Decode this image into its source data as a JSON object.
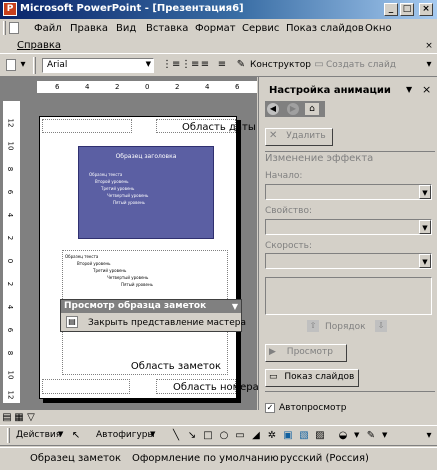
{
  "window": {
    "title": "Microsoft PowerPoint - [Презентация6]"
  },
  "menu": [
    "Файл",
    "Правка",
    "Вид",
    "Вставка",
    "Формат",
    "Сервис",
    "Показ слайдов",
    "Окно",
    "Справка"
  ],
  "formatting": {
    "font": "Arial",
    "designer": "Конструктор",
    "new_slide": "Создать слайд"
  },
  "ruler_top": [
    "6",
    "4",
    "2",
    "0",
    "2",
    "4",
    "6"
  ],
  "ruler_left": [
    "12",
    "10",
    "8",
    "6",
    "4",
    "2",
    "0",
    "2",
    "4",
    "6",
    "8",
    "10",
    "12"
  ],
  "page": {
    "header_area": "Область даты",
    "slide_title": "Образец заголовка",
    "slide_bullets": [
      "Образец текста",
      "Второй уровень",
      "Третий уровень",
      "Четвертый уровень",
      "Пятый уровень"
    ],
    "notes_lines": [
      "Образец текста",
      "Второй уровень",
      "Третий уровень",
      "Четвертый уровень",
      "Пятый уровень"
    ],
    "notes_area": "Область заметок",
    "number_area": "Область номера"
  },
  "notes_master_toolbar": {
    "title": "Просмотр образца заметок",
    "close": "Закрыть представление мастера"
  },
  "task_pane": {
    "title": "Настройка анимации",
    "delete": "Удалить",
    "section": "Изменение эффекта",
    "start_label": "Начало:",
    "property_label": "Свойство:",
    "speed_label": "Скорость:",
    "order": "Порядок",
    "preview": "Просмотр",
    "slideshow": "Показ слайдов",
    "autopreview": "Автопросмотр"
  },
  "drawing": {
    "actions": "Действия",
    "autoshapes": "Автофигуры"
  },
  "status": {
    "view": "Образец заметок",
    "design": "Оформление по умолчанию",
    "language": "русский (Россия)"
  }
}
